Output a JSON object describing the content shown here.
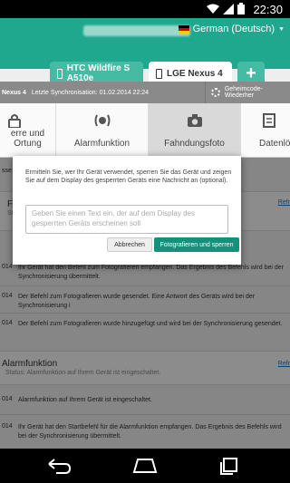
{
  "status_bar": {
    "time": "22:30"
  },
  "app": {
    "language": "German (Deutsch)",
    "tabs": [
      {
        "label": "HTC Wildfire S A510e"
      },
      {
        "label": "LGE Nexus 4"
      }
    ],
    "add_tab": "+"
  },
  "device_strip": {
    "name": "Nexus 4",
    "sync": "Letzte Synchronisation: 01.02.2014 22:24",
    "secret_code": "Geheimcode-Wiederher"
  },
  "functions": [
    {
      "label": "erre und Ortung",
      "icon": "lock-icon"
    },
    {
      "label": "Alarmfunktion",
      "icon": "alarm-icon"
    },
    {
      "label": "Fahndungsfoto",
      "icon": "camera-icon"
    },
    {
      "label": "Datenlös",
      "icon": "document-icon"
    }
  ],
  "content": {
    "header_cut": "sse",
    "card1": {
      "title": "Fa",
      "status": "Stat",
      "link": "Refr"
    },
    "entries1": [
      {
        "date": "014",
        "text": "Ihr Gerät hat den Befehl zum Fotografieren empfangen. Das Ergebnis des Befehls wird bei der Synchronisierung übermittelt."
      },
      {
        "date": "014",
        "text": "Der Befehl zum Fotografieren wurde gesendet. Eine Antwort des Geräts wird bei der Synchronisierung i"
      },
      {
        "date": "014",
        "text": "Der Befehl zum Fotografieren wurde hinzugefügt und wird bei der Synchronisierung gesendet."
      }
    ],
    "card2": {
      "title": "Alarmfunktion",
      "status": "Status: Alarmfunktion auf Ihrem Gerät ist eingeschaltet.",
      "link": "Refr"
    },
    "entries2": [
      {
        "date": "014",
        "text": "Alarmfunktion auf Ihrem Gerät ist eingeschaltet."
      },
      {
        "date": "014",
        "text": "Ihr Gerät hat den Startbefehl für die Alarmfunktion empfangen. Das Ergebnis des Befehls wird bei der Synchronisierung übermittelt."
      }
    ]
  },
  "dialog": {
    "intro": "Ermitteln Sie, wer Ihr Gerät verwendet, sperren Sie das Gerät und zeigen Sie auf dem Display des gesperrten Geräts eine Nachricht an (optional).",
    "placeholder": "Geben Sie einen Text ein, der auf dem Display des gesperrten Geräts erscheinen soll",
    "cancel": "Abbrechen",
    "confirm": "Fotografieren und sperren"
  },
  "colors": {
    "brand": "#1fa88e",
    "primary_button": "#16907a",
    "link": "#1a77c9"
  }
}
